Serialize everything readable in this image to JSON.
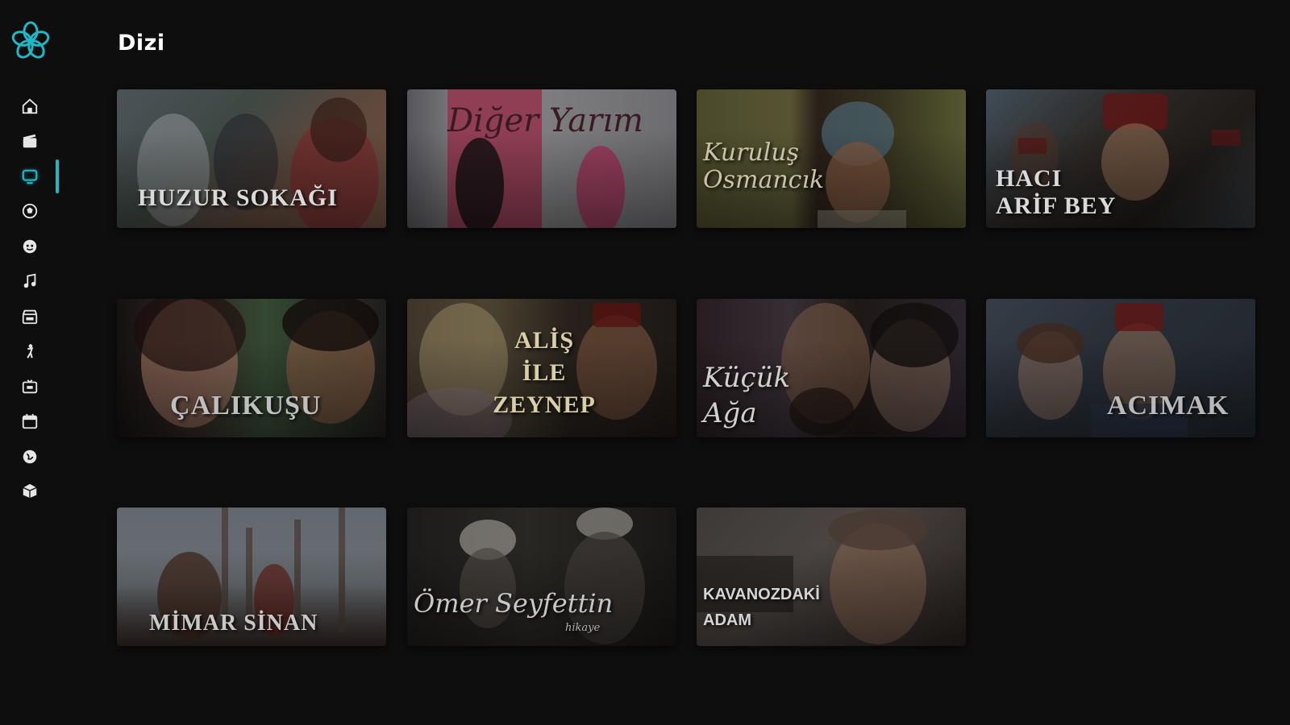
{
  "app": {
    "accent_color": "#1fb8c4",
    "logo_icon": "flower-logo-icon"
  },
  "sidebar": {
    "items": [
      {
        "id": "home",
        "icon": "home-icon",
        "active": false
      },
      {
        "id": "movies",
        "icon": "clapperboard-icon",
        "active": false
      },
      {
        "id": "series",
        "icon": "tv-icon",
        "active": true
      },
      {
        "id": "sports",
        "icon": "ball-icon",
        "active": false
      },
      {
        "id": "kids",
        "icon": "face-icon",
        "active": false
      },
      {
        "id": "music",
        "icon": "music-note-icon",
        "active": false
      },
      {
        "id": "shows",
        "icon": "film-slate-icon",
        "active": false
      },
      {
        "id": "culture",
        "icon": "figure-icon",
        "active": false
      },
      {
        "id": "live",
        "icon": "channel-icon",
        "active": false
      },
      {
        "id": "schedule",
        "icon": "calendar-icon",
        "active": false
      },
      {
        "id": "search",
        "icon": "globe-icon",
        "active": false
      },
      {
        "id": "archive",
        "icon": "box-icon",
        "active": false
      }
    ]
  },
  "page": {
    "title": "Dizi"
  },
  "grid": {
    "items": [
      {
        "title": "HUZUR SOKAĞI"
      },
      {
        "title": "Diğer Yarım"
      },
      {
        "title": "Kuruluş\nOsmancık"
      },
      {
        "title": "HACI\nARİF BEY"
      },
      {
        "title": "ÇALIKUŞU"
      },
      {
        "title": "ALİŞ\nİLE\nZEYNEP"
      },
      {
        "title": "Küçük\nAğa"
      },
      {
        "title": "ACIMAK"
      },
      {
        "title": "MİMAR SİNAN"
      },
      {
        "title": "Ömer Seyfettin",
        "subtitle": "hikaye"
      },
      {
        "title": "KAVANOZDAKİ\nADAM"
      }
    ]
  }
}
